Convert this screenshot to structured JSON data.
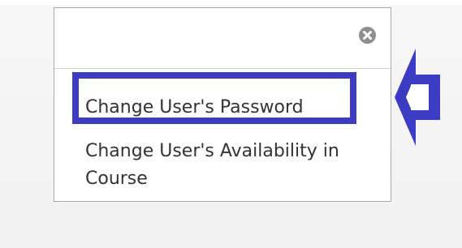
{
  "menu": {
    "close_icon": "close-circle-icon",
    "items": [
      {
        "label": "Change User's Password",
        "highlighted": true
      },
      {
        "label": "Change User's Availability in Course",
        "highlighted": false
      }
    ]
  },
  "annotation": {
    "arrow_icon": "left-arrow-icon",
    "color": "#3b3bc4"
  },
  "colors": {
    "panel_border": "#a9a9a9",
    "text": "#333333",
    "close_icon": "#8f8f8f",
    "highlight": "#3b3bc4"
  }
}
